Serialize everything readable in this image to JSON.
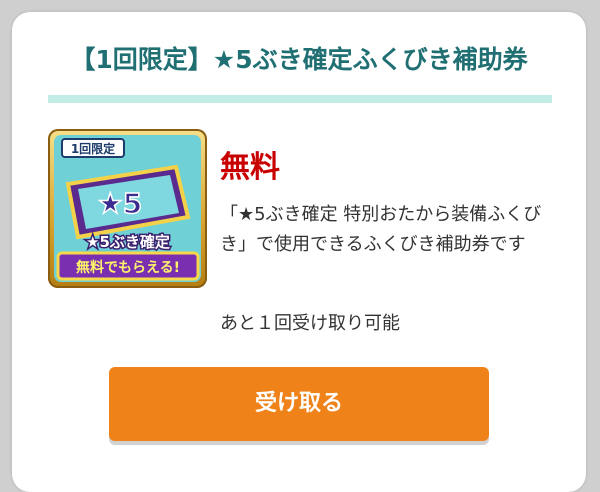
{
  "card": {
    "title": "【1回限定】★5ぶき確定ふくびき補助券",
    "price": "無料",
    "description": "「★5ぶき確定 特別おたから装備ふくびき」で使用できるふくびき補助券です",
    "remaining": "あと１回受け取り可能",
    "claim_button": "受け取る"
  },
  "ticket_image": {
    "top_badge": "1回限定",
    "star_text": "★5",
    "mid_text": "★5ぶき確定",
    "bottom_text": "無料でもらえる!"
  },
  "colors": {
    "title": "#1f6f73",
    "divider": "#c4ece6",
    "price": "#c80000",
    "button": "#ef8219",
    "text": "#333333"
  }
}
